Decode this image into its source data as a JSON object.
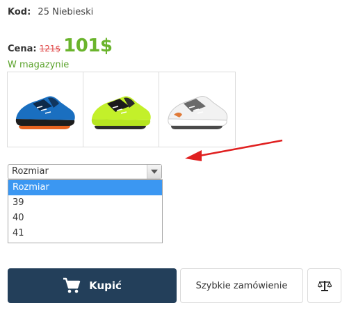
{
  "product": {
    "code_label": "Kod:",
    "code_value": "25 Niebieski",
    "price_label": "Cena:",
    "old_price": "121$",
    "new_price": "101$",
    "stock": "W magazynie"
  },
  "thumbnails": [
    {
      "icon": "blue-running-shoe-image"
    },
    {
      "icon": "lime-running-shoe-image"
    },
    {
      "icon": "white-running-shoe-image"
    }
  ],
  "size_select": {
    "selected": "Rozmiar",
    "options": [
      "Rozmiar",
      "39",
      "40",
      "41"
    ]
  },
  "actions": {
    "buy_label": "Kupić",
    "quick_order_label": "Szybkie zamówienie"
  },
  "colors": {
    "accent_button": "#233f5a",
    "price_green": "#6ab42c",
    "old_price_red": "#e04848",
    "stock_green": "#5aa22a",
    "dropdown_highlight": "#3b97f2",
    "annotation_arrow": "#e02020"
  }
}
